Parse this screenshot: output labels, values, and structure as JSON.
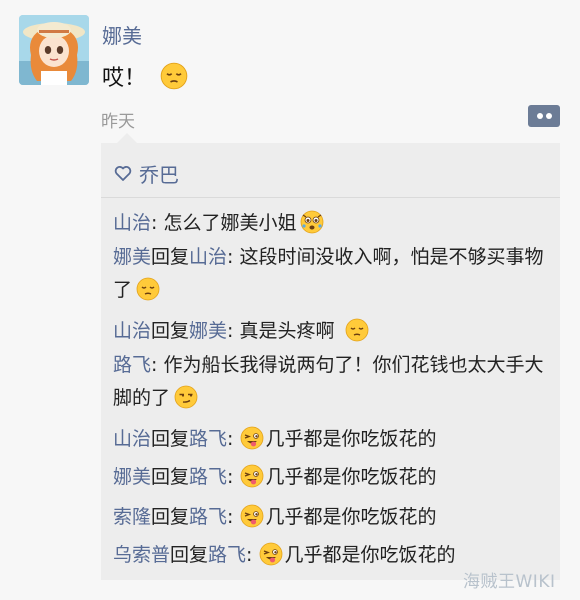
{
  "post": {
    "author": "娜美",
    "text": "哎！",
    "text_emoji": "sigh-emoji",
    "time": "昨天"
  },
  "likes": {
    "icon": "heart-outline-icon",
    "names": "乔巴"
  },
  "comments": [
    {
      "name": "山治",
      "reply_word": "",
      "reply_to": "",
      "sep": ": ",
      "text": "怎么了娜美小姐",
      "emoji": "worried-emoji"
    },
    {
      "name": "娜美",
      "reply_word": "回复",
      "reply_to": "山治",
      "sep": ": ",
      "text": "这段时间没收入啊，怕是不够买事物了",
      "emoji": "sigh-emoji"
    },
    {
      "name": "山治",
      "reply_word": "回复",
      "reply_to": "娜美",
      "sep": ": ",
      "text": "真是头疼啊",
      "emoji": "sigh-emoji"
    },
    {
      "name": "路飞",
      "reply_word": "",
      "reply_to": "",
      "sep": ": ",
      "text": "作为船长我得说两句了！你们花钱也太大手大脚的了",
      "emoji": "smirk-emoji"
    },
    {
      "name": "山治",
      "reply_word": "回复",
      "reply_to": "路飞",
      "sep": ": ",
      "text": "几乎都是你吃饭花的",
      "emoji": "tongue-emoji"
    },
    {
      "name": "娜美",
      "reply_word": "回复",
      "reply_to": "路飞",
      "sep": ": ",
      "text": "几乎都是你吃饭花的",
      "emoji": "tongue-emoji"
    },
    {
      "name": "索隆",
      "reply_word": "回复",
      "reply_to": "路飞",
      "sep": ": ",
      "text": "几乎都是你吃饭花的",
      "emoji": "tongue-emoji"
    },
    {
      "name": "乌索普",
      "reply_word": "回复",
      "reply_to": "路飞",
      "sep": ": ",
      "text": "几乎都是你吃饭花的",
      "emoji": "tongue-emoji"
    }
  ],
  "watermark": "海贼王WIKI",
  "colors": {
    "name_link": "#576b95",
    "comment_bg": "#ededed",
    "page_bg": "#f7f7f7",
    "more_button": "#6c7c96"
  }
}
